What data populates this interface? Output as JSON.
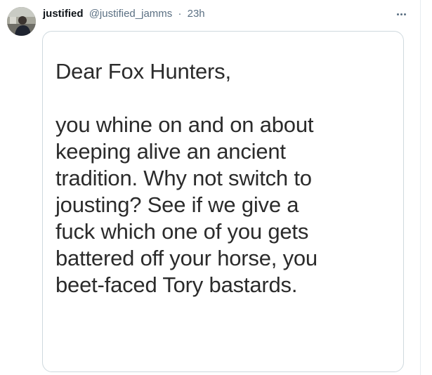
{
  "tweet": {
    "author": {
      "display_name": "justified",
      "handle": "@justified_jamms",
      "separator": "·",
      "timestamp": "23h"
    },
    "more_icon": "more-horizontal-icon",
    "image_text": {
      "greeting": "Dear Fox Hunters,",
      "body_lines": [
        "you whine on and on about",
        "keeping alive an ancient",
        "tradition. Why not switch to",
        "jousting? See if we give a",
        "fuck which one of you gets",
        "battered off your horse, you",
        "beet-faced Tory bastards."
      ]
    }
  },
  "colors": {
    "text_primary": "#0f1419",
    "text_secondary": "#5b7083",
    "border": "#cfd9de",
    "image_text": "#2b2b2b"
  }
}
